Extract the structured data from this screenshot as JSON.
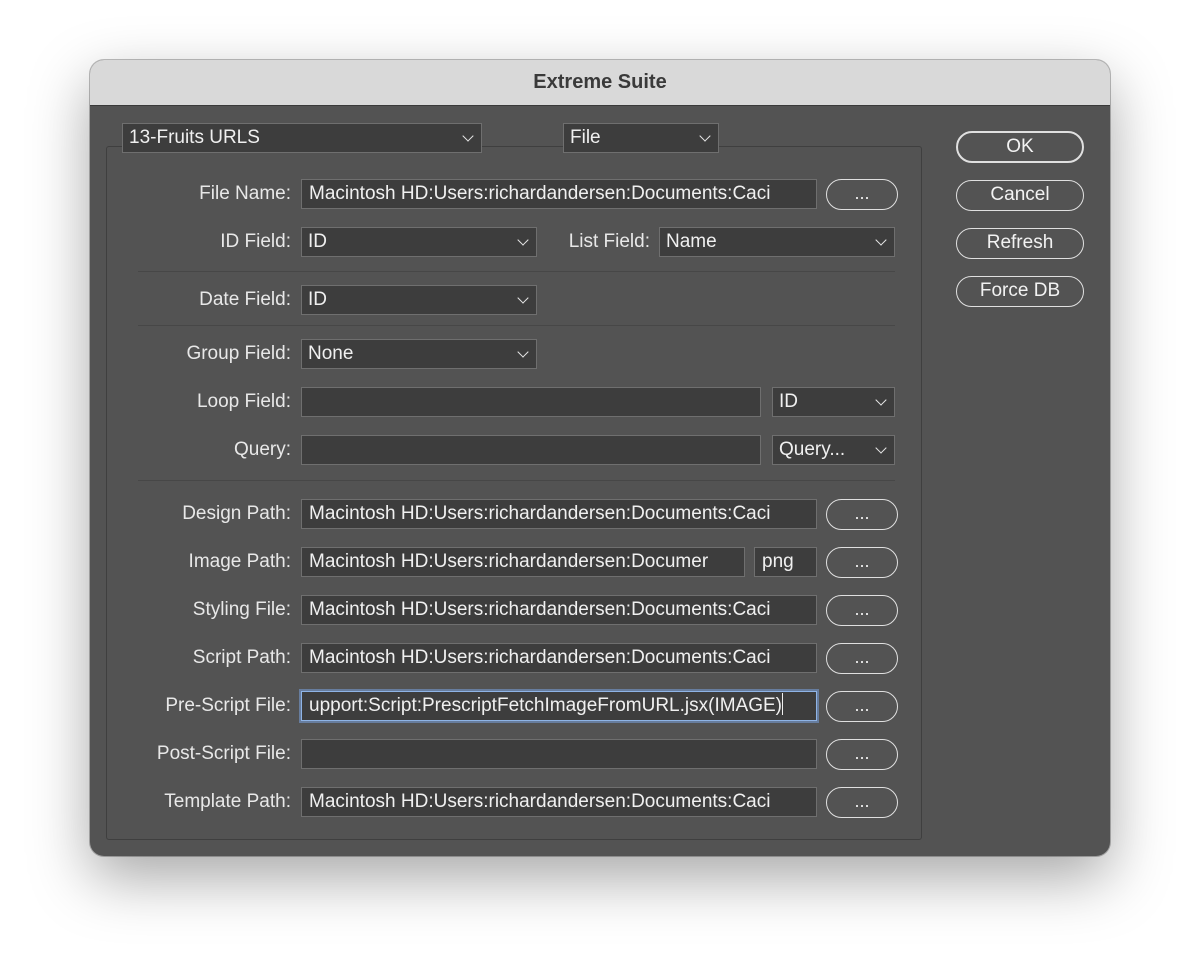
{
  "window": {
    "title": "Extreme Suite"
  },
  "top": {
    "dataset": "13-Fruits URLS",
    "source_type": "File"
  },
  "buttons": {
    "ok": "OK",
    "cancel": "Cancel",
    "refresh": "Refresh",
    "force_db": "Force DB",
    "browse": "..."
  },
  "fields": {
    "file_name": {
      "label": "File Name:",
      "value": "Macintosh HD:Users:richardandersen:Documents:Caci"
    },
    "id_field": {
      "label": "ID Field:",
      "value": "ID"
    },
    "list_field": {
      "label": "List Field:",
      "value": "Name"
    },
    "date_field": {
      "label": "Date Field:",
      "value": "ID"
    },
    "group_field": {
      "label": "Group Field:",
      "value": "None"
    },
    "loop_field": {
      "label": "Loop Field:",
      "value": "",
      "select": "ID"
    },
    "query": {
      "label": "Query:",
      "value": "",
      "select": "Query..."
    },
    "design_path": {
      "label": "Design Path:",
      "value": "Macintosh HD:Users:richardandersen:Documents:Caci"
    },
    "image_path": {
      "label": "Image Path:",
      "value": "Macintosh HD:Users:richardandersen:Documer",
      "ext": "png"
    },
    "styling_file": {
      "label": "Styling File:",
      "value": "Macintosh HD:Users:richardandersen:Documents:Caci"
    },
    "script_path": {
      "label": "Script Path:",
      "value": "Macintosh HD:Users:richardandersen:Documents:Caci"
    },
    "prescript_file": {
      "label": "Pre-Script File:",
      "value": "upport:Script:PrescriptFetchImageFromURL.jsx(IMAGE)"
    },
    "postscript_file": {
      "label": "Post-Script File:",
      "value": ""
    },
    "template_path": {
      "label": "Template Path:",
      "value": "Macintosh HD:Users:richardandersen:Documents:Caci"
    }
  }
}
